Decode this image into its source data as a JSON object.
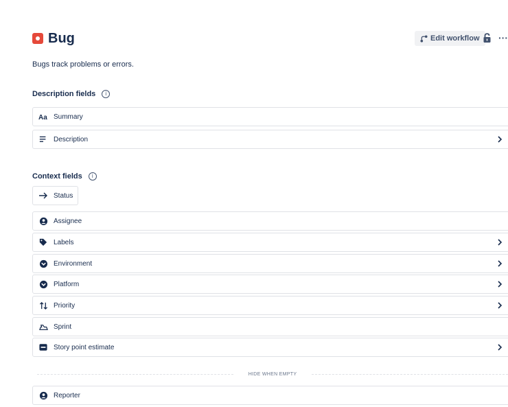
{
  "header": {
    "title": "Bug",
    "subtitle": "Bugs track problems or errors.",
    "edit_workflow_label": "Edit workflow",
    "more_label": "···"
  },
  "description_section": {
    "heading": "Description fields",
    "info_glyph": "i",
    "fields": [
      {
        "label": "Summary",
        "icon": "text-aa-icon",
        "chevron": false
      },
      {
        "label": "Description",
        "icon": "text-lines-icon",
        "chevron": true
      }
    ]
  },
  "context_section": {
    "heading": "Context fields",
    "info_glyph": "i",
    "status_label": "Status",
    "fields": [
      {
        "label": "Assignee",
        "icon": "person-icon",
        "chevron": false
      },
      {
        "label": "Labels",
        "icon": "tag-icon",
        "chevron": true
      },
      {
        "label": "Environment",
        "icon": "dropdown-circle-icon",
        "chevron": true
      },
      {
        "label": "Platform",
        "icon": "dropdown-circle-icon",
        "chevron": true
      },
      {
        "label": "Priority",
        "icon": "priority-arrows-icon",
        "chevron": true
      },
      {
        "label": "Sprint",
        "icon": "sprint-icon",
        "chevron": false
      },
      {
        "label": "Story point estimate",
        "icon": "number-badge-icon",
        "chevron": true
      }
    ],
    "divider_label": "HIDE WHEN EMPTY",
    "hidden_fields": [
      {
        "label": "Reporter",
        "icon": "person-icon",
        "chevron": false
      }
    ]
  },
  "colors": {
    "bug_red": "#e5493a",
    "text": "#172b4d",
    "border": "#dfe1e6",
    "button_bg": "#f1f2f4"
  }
}
